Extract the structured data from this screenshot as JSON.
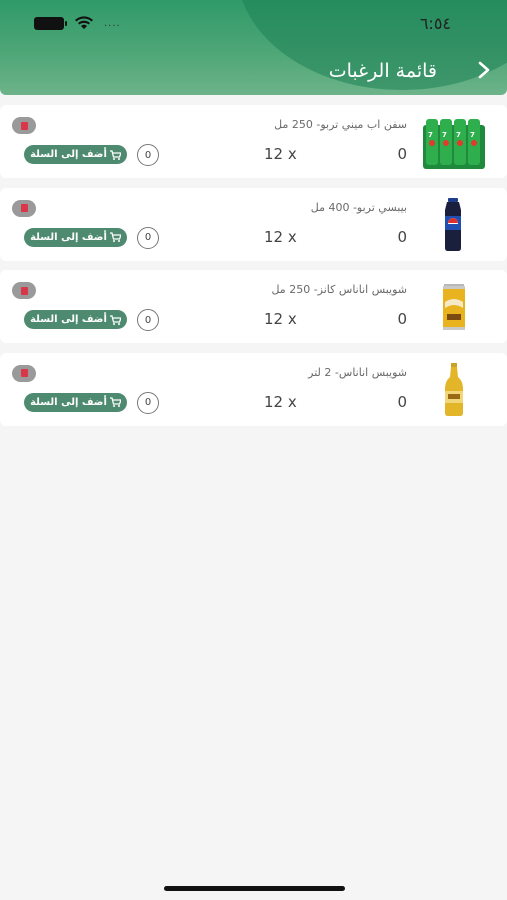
{
  "status_bar": {
    "time": "٦:٥٤",
    "signal": "...."
  },
  "header": {
    "title": "قائمة الرغبات",
    "accent": "#3a9d6c"
  },
  "add_label": "أضف إلى السلة",
  "items": [
    {
      "name": "سفن اب ميني تربو- 250 مل",
      "price": "0",
      "qty": "12 x",
      "count": "0",
      "image": "7up-pack"
    },
    {
      "name": "بيبسي تربو- 400 مل",
      "price": "0",
      "qty": "12 x",
      "count": "0",
      "image": "pepsi-bottle"
    },
    {
      "name": "شويبس اناناس كانز- 250 مل",
      "price": "0",
      "qty": "12 x",
      "count": "0",
      "image": "schweppes-can"
    },
    {
      "name": "شويبس اناناس- 2 لتر",
      "price": "0",
      "qty": "12 x",
      "count": "0",
      "image": "schweppes-bottle"
    }
  ]
}
